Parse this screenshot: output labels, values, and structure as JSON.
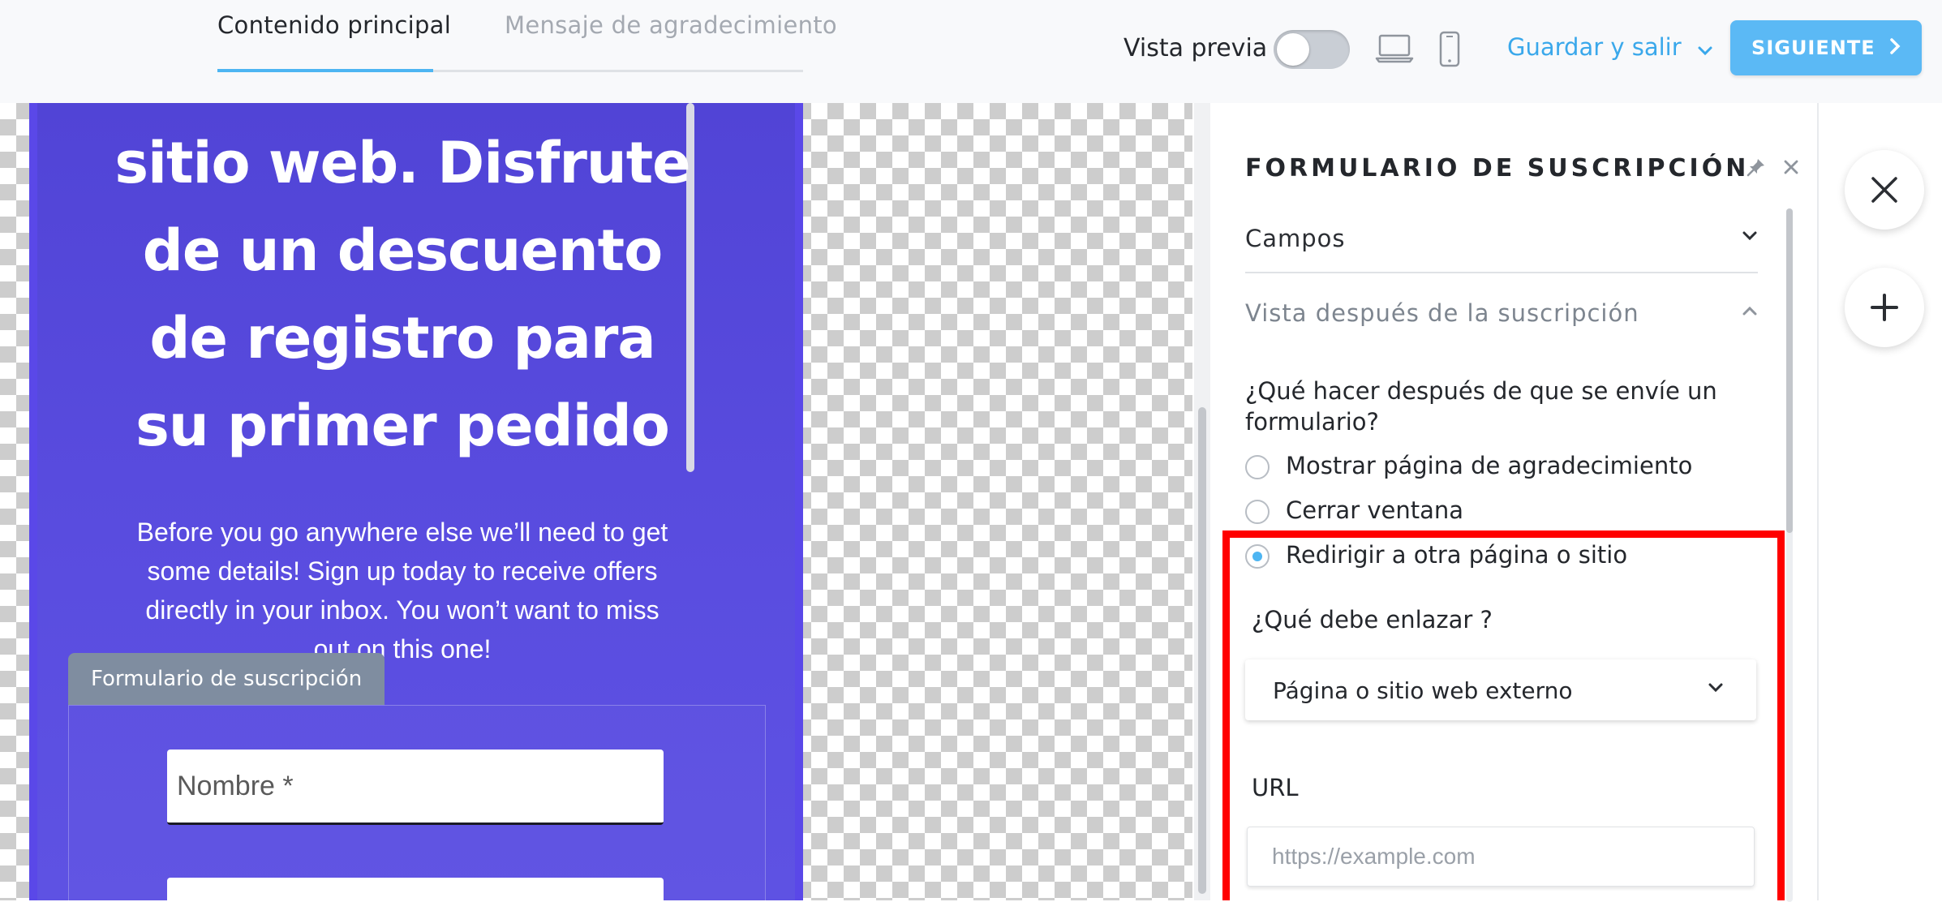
{
  "tabs": [
    {
      "label": "Contenido principal",
      "active": true
    },
    {
      "label": "Mensaje de agradecimiento",
      "active": false
    }
  ],
  "toolbar": {
    "preview_label": "Vista previa",
    "preview_on": false,
    "save_exit_label": "Guardar y salir",
    "next_label": "SIGUIENTE",
    "accent_color": "#5bb9f5"
  },
  "popup": {
    "headline": "sitio web. Disfrute de un descuento de registro para su primer pedido",
    "body": "Before you go anywhere else we’ll need to get some details! Sign up today to receive offers directly in your inbox. You won’t want to miss out on this one!",
    "form_tag": "Formulario de suscripción",
    "name_placeholder": "Nombre *",
    "background_color": "#5144d6"
  },
  "panel": {
    "title": "FORMULARIO DE SUSCRIPCIÓN",
    "sections": [
      {
        "label": "Campos",
        "expanded": false
      },
      {
        "label": "Vista después de la suscripción",
        "expanded": true
      }
    ],
    "question": "¿Qué hacer después de que se envíe un formulario?",
    "options": [
      {
        "label": "Mostrar página de agradecimiento",
        "checked": false
      },
      {
        "label": "Cerrar ventana",
        "checked": false
      },
      {
        "label": "Redirigir a otra página o sitio",
        "checked": true
      }
    ],
    "link_label": "¿Qué debe enlazar ?",
    "link_select_value": "Página o sitio web externo",
    "url_label": "URL",
    "url_placeholder": "https://example.com",
    "highlight_color": "#ff0000"
  },
  "side_actions": {
    "icons": [
      "close-icon",
      "plus-icon"
    ]
  }
}
